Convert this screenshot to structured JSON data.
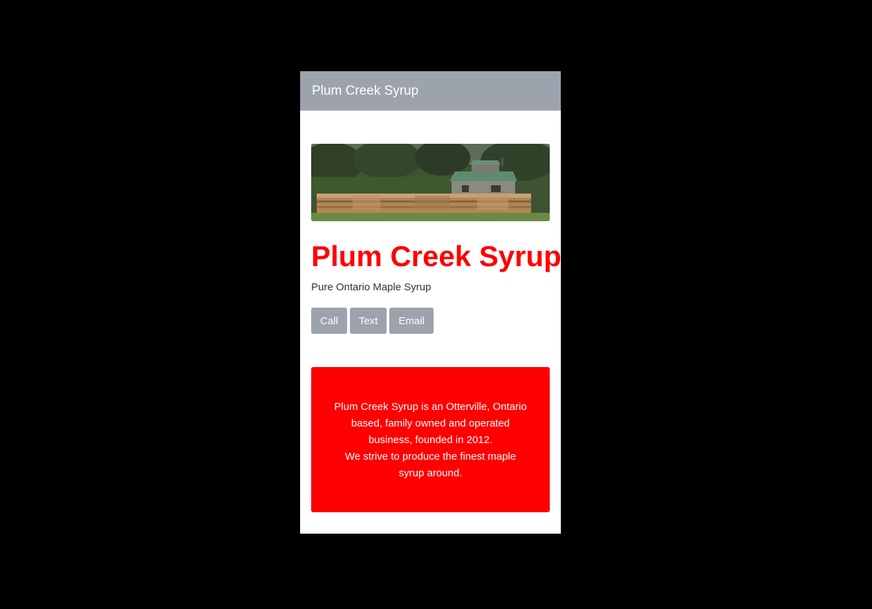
{
  "navbar": {
    "brand": "Plum Creek Syrup"
  },
  "hero": {
    "image_description": "sugar shack with stacked firewood"
  },
  "header": {
    "title": "Plum Creek Syrup",
    "subtitle": "Pure Ontario Maple Syrup"
  },
  "actions": {
    "call_label": "Call",
    "text_label": "Text",
    "email_label": "Email"
  },
  "about": {
    "line1": "Plum Creek Syrup is an Otterville, Ontario based, family owned and operated business, founded in 2012.",
    "line2": "We strive to produce the finest maple syrup around."
  },
  "colors": {
    "accent": "#ff0000",
    "navbar": "#9ca3ad",
    "button": "#9ca3ad",
    "background": "#000000"
  }
}
